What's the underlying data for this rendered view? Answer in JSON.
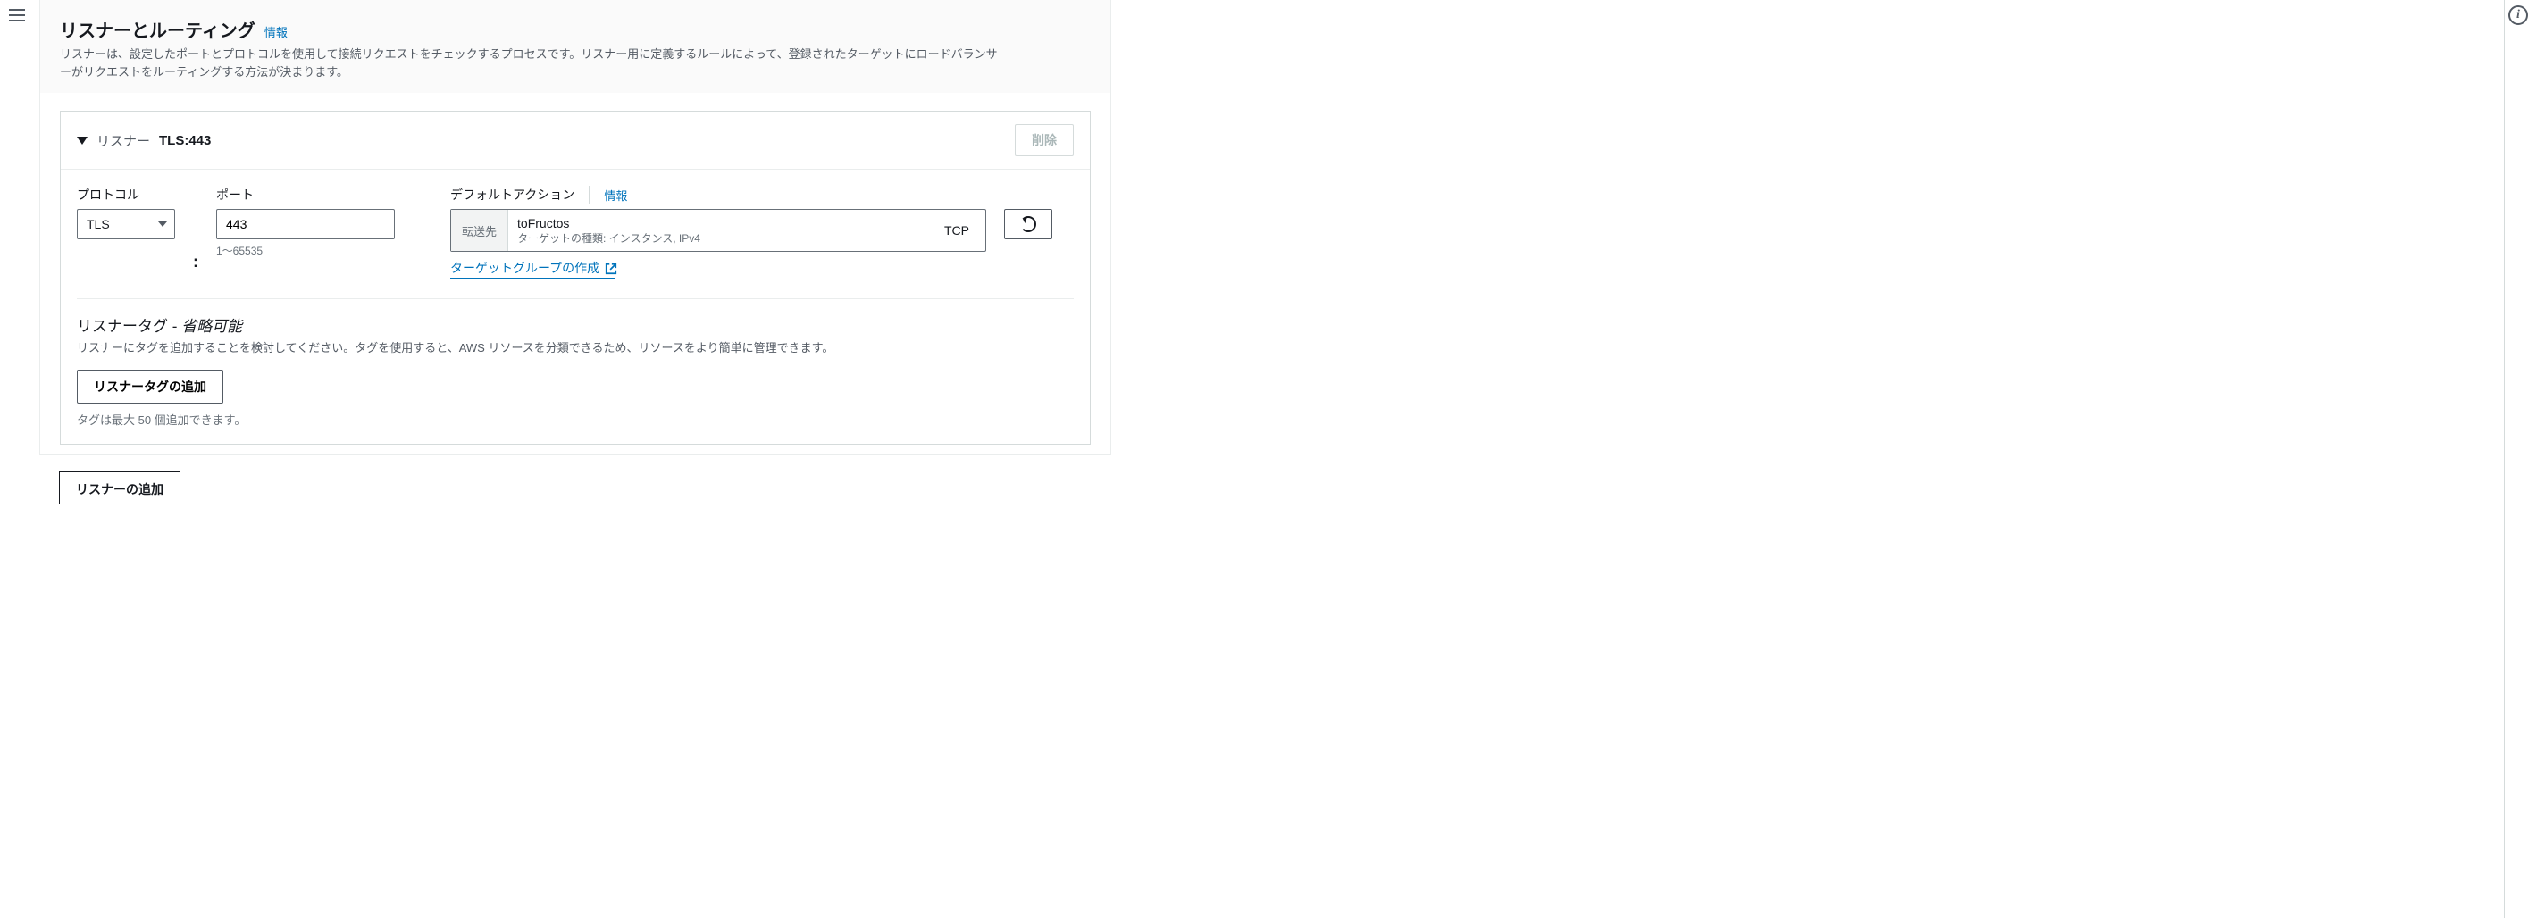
{
  "header": {
    "title": "リスナーとルーティング",
    "infoLink": "情報",
    "description": "リスナーは、設定したポートとプロトコルを使用して接続リクエストをチェックするプロセスです。リスナー用に定義するルールによって、登録されたターゲットにロードバランサーがリクエストをルーティングする方法が決まります。"
  },
  "listener": {
    "caretExpanded": true,
    "label": "リスナー",
    "value": "TLS:443",
    "deleteLabel": "削除",
    "protocolLabel": "プロトコル",
    "protocolValue": "TLS",
    "portLabel": "ポート",
    "portValue": "443",
    "portHint": "1～65535",
    "defaultActionLabel": "デフォルトアクション",
    "defaultActionInfo": "情報",
    "action": {
      "prefix": "転送先",
      "target": "toFructos",
      "sub": "ターゲットの種類: インスタンス, IPv4",
      "proto": "TCP"
    },
    "createTargetGroupLink": "ターゲットグループの作成",
    "tagsTitle": "リスナータグ",
    "tagsDash": " - ",
    "tagsOptional": "省略可能",
    "tagsDesc": "リスナーにタグを追加することを検討してください。タグを使用すると、AWS リソースを分類できるため、リソースをより簡単に管理できます。",
    "addTagLabel": "リスナータグの追加",
    "tagLimitHint": "タグは最大 50 個追加できます。"
  },
  "addListenerLabel": "リスナーの追加"
}
